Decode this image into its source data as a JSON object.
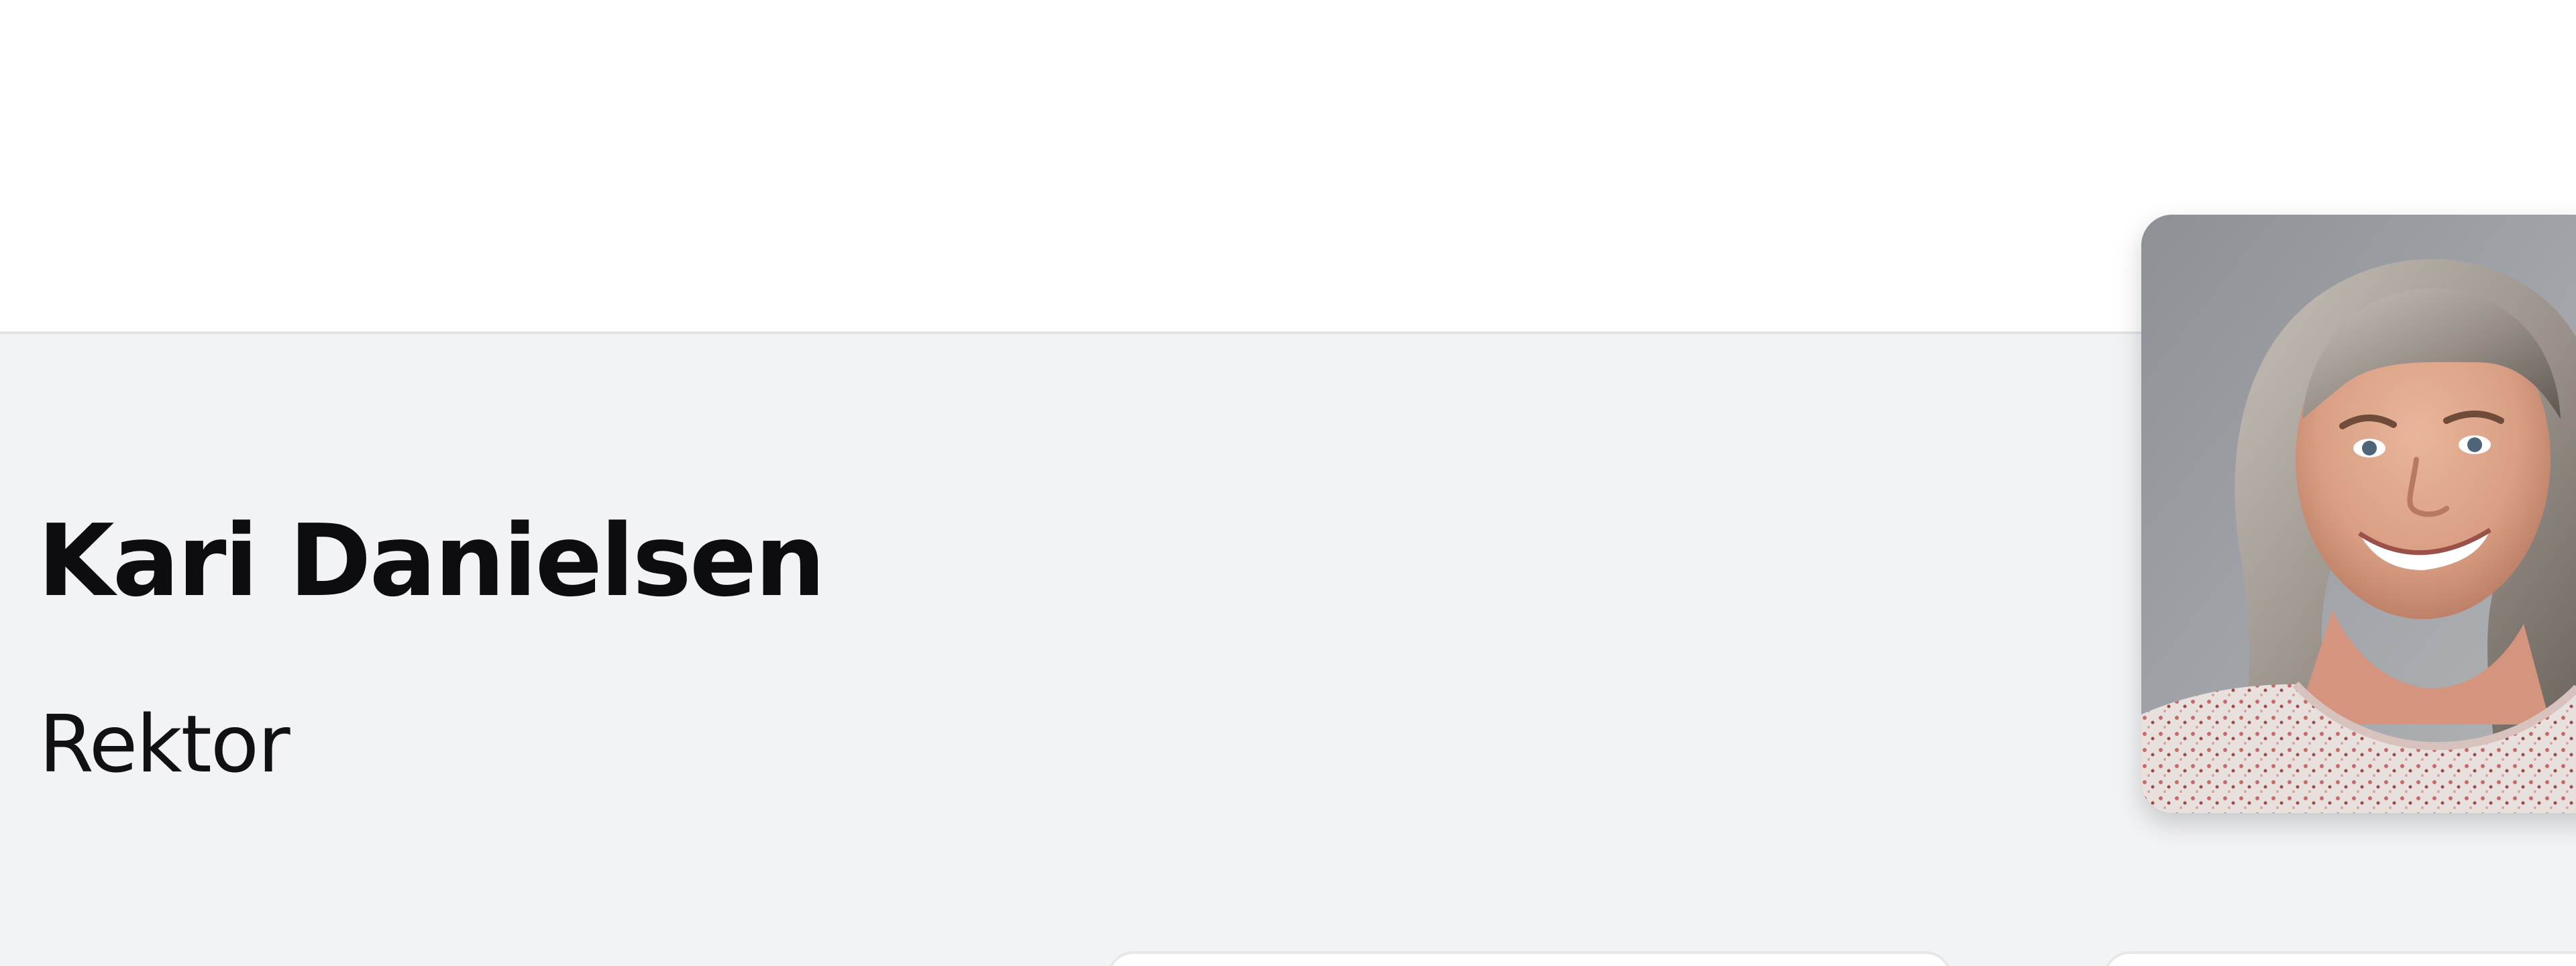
{
  "profile": {
    "name": "Kari Danielsen",
    "role": "Rektor",
    "photo_alt": "Kari Danielsen",
    "colors": {
      "section_background": "#f2f3f5",
      "text": "#0d0d0f"
    }
  },
  "cards": [
    {
      "label": ""
    },
    {
      "label": ""
    }
  ]
}
